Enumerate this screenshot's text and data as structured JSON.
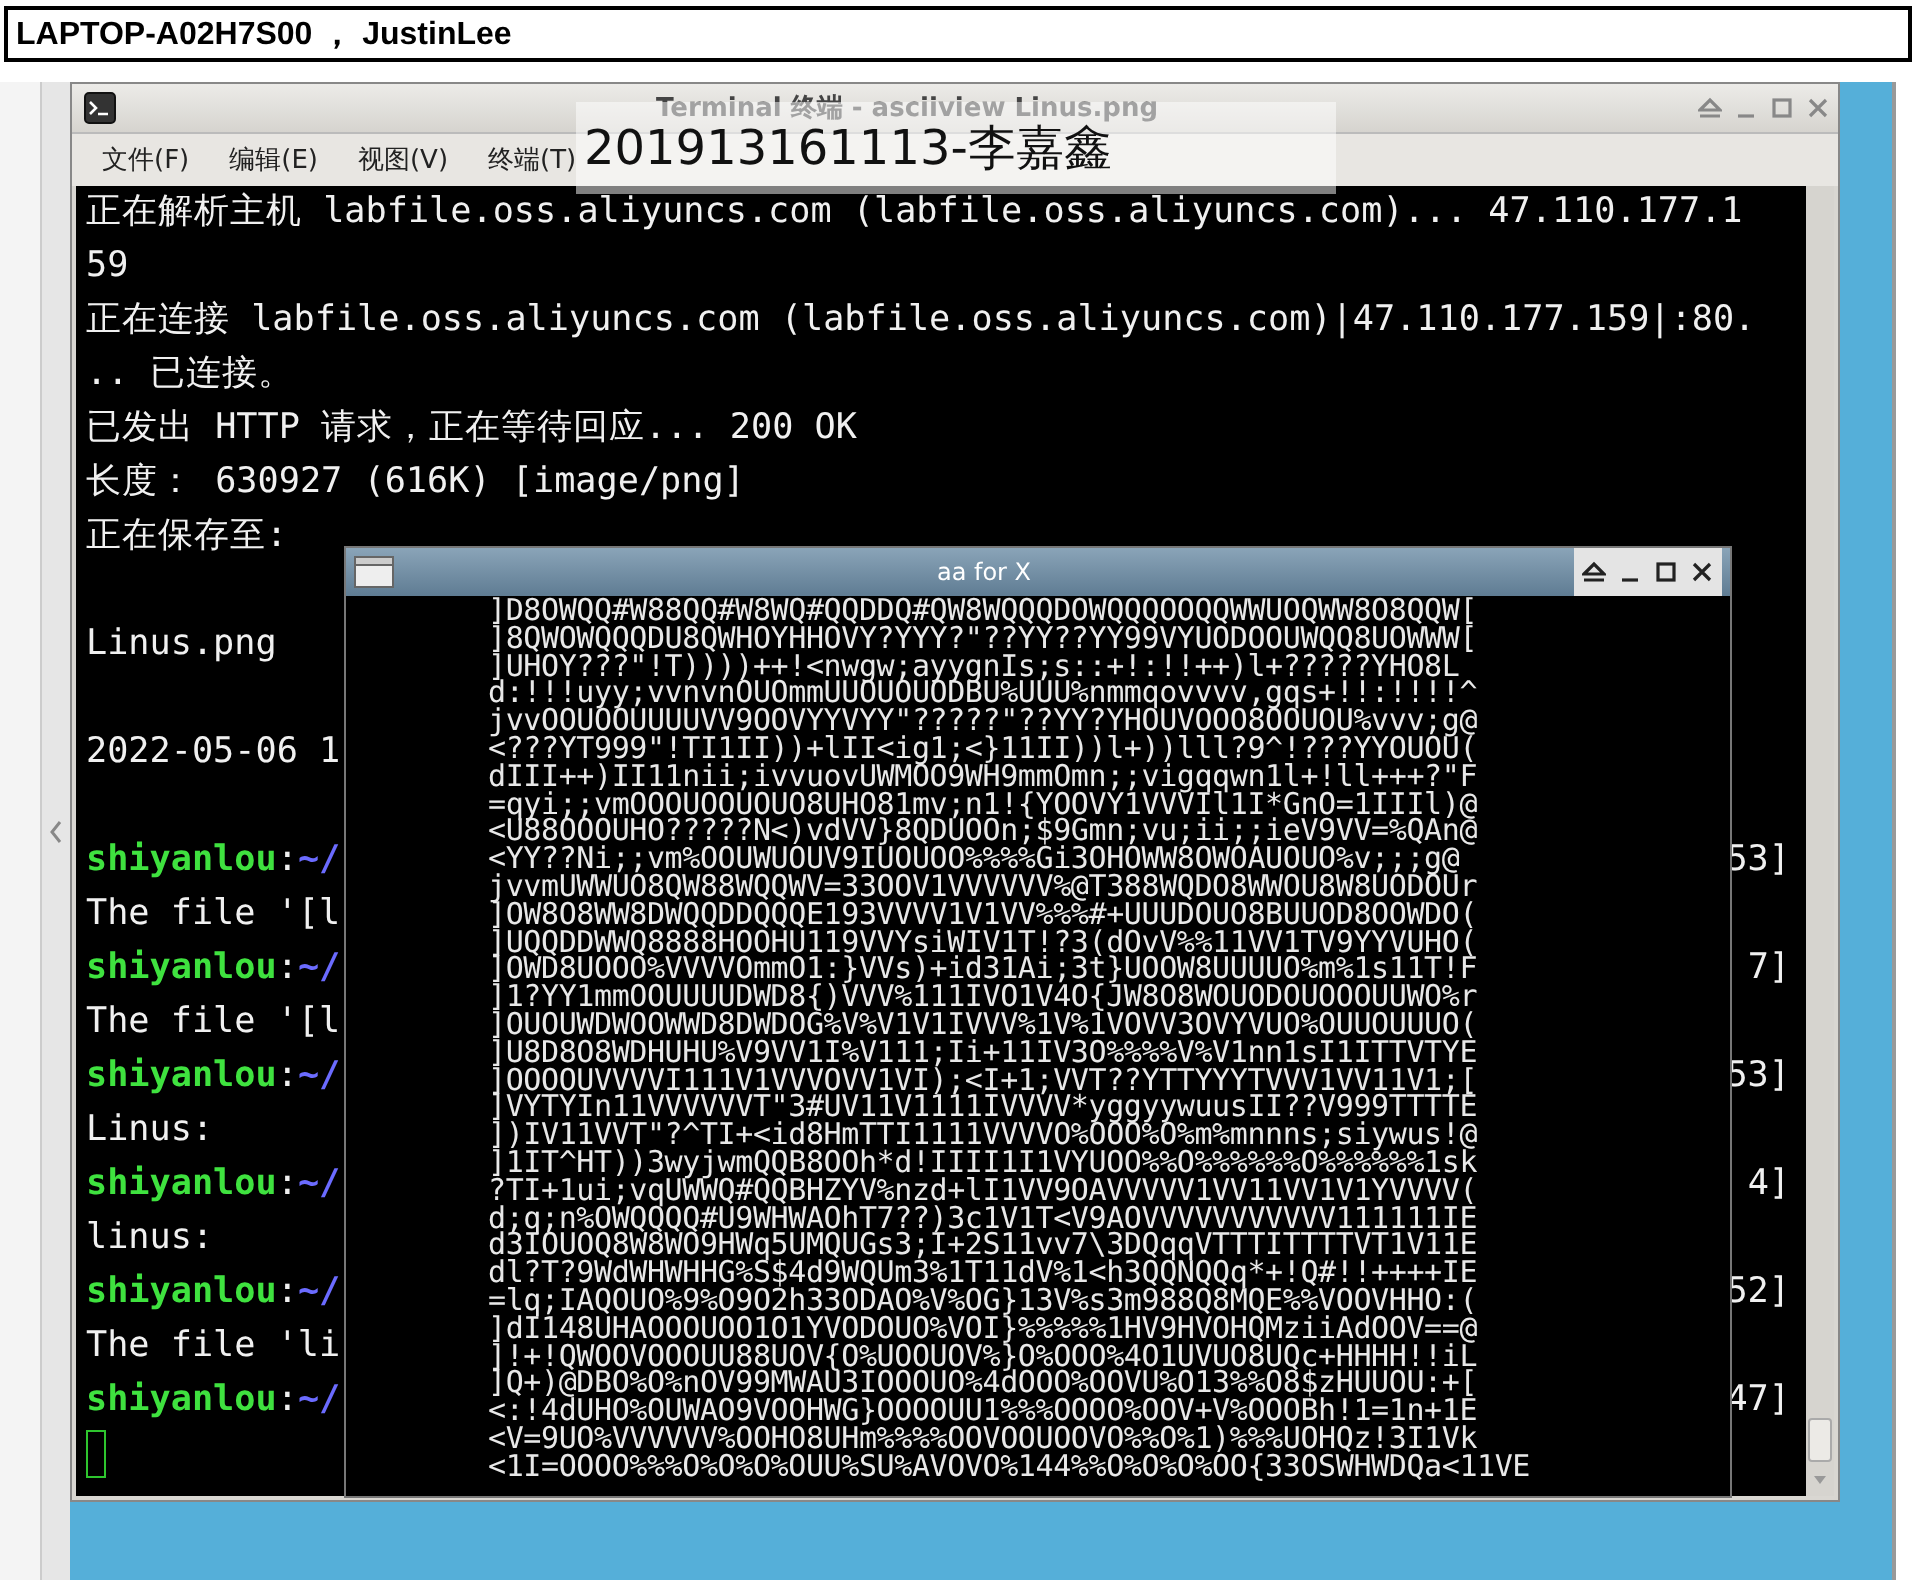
{
  "host_bar": {
    "title": "LAPTOP-A02H7S00 ， JustinLee"
  },
  "overlay_label": "201913161113-李嘉鑫",
  "terminal": {
    "title": "Terminal 终端 - asciiview Linus.png",
    "menu": [
      "文件(F)",
      "编辑(E)",
      "视图(V)",
      "终端(T)"
    ],
    "lines": [
      {
        "kind": "text",
        "text": "正在解析主机 labfile.oss.aliyuncs.com (labfile.oss.aliyuncs.com)... 47.110.177.1"
      },
      {
        "kind": "text",
        "text": "59"
      },
      {
        "kind": "text",
        "text": "正在连接 labfile.oss.aliyuncs.com (labfile.oss.aliyuncs.com)|47.110.177.159|:80."
      },
      {
        "kind": "text",
        "text": ".. 已连接。"
      },
      {
        "kind": "text",
        "text": "已发出 HTTP 请求，正在等待回应... 200 OK"
      },
      {
        "kind": "text",
        "text": "长度： 630927 (616K) [image/png]"
      },
      {
        "kind": "text",
        "text": "正在保存至:"
      },
      {
        "kind": "blank"
      },
      {
        "kind": "text",
        "text": "Linus.png"
      },
      {
        "kind": "blank"
      },
      {
        "kind": "text",
        "text": "2022-05-06 1"
      },
      {
        "kind": "blank"
      },
      {
        "kind": "prompt",
        "user": "shiyanlou",
        "separator": ":",
        "path": "~/",
        "tail": "53]"
      },
      {
        "kind": "text",
        "text": "The file '[l"
      },
      {
        "kind": "prompt",
        "user": "shiyanlou",
        "separator": ":",
        "path": "~/",
        "tail": "7]"
      },
      {
        "kind": "text",
        "text": "The file '[l"
      },
      {
        "kind": "prompt",
        "user": "shiyanlou",
        "separator": ":",
        "path": "~/",
        "tail": "53]"
      },
      {
        "kind": "text",
        "text": "Linus:"
      },
      {
        "kind": "prompt",
        "user": "shiyanlou",
        "separator": ":",
        "path": "~/",
        "tail": "4]"
      },
      {
        "kind": "text",
        "text": "linus:"
      },
      {
        "kind": "prompt",
        "user": "shiyanlou",
        "separator": ":",
        "path": "~/",
        "tail": "52]"
      },
      {
        "kind": "text",
        "text": "The file 'li"
      },
      {
        "kind": "prompt",
        "user": "shiyanlou",
        "separator": ":",
        "path": "~/",
        "tail": "47]"
      },
      {
        "kind": "cursor"
      }
    ]
  },
  "aa_window": {
    "title": "aa for X",
    "art_lines": [
      "]D8OWQQ#W88QQ#W8WQ#QQDDQ#QW8WQQQDOWQQQOOQQWWUOQWW8O8QQW[",
      "]8QWOWQQQDU8QWHOYHHOVY?YYY?\"??YY??YY99VYUODOOUWQQ8UOWWW[",
      "]UHOY???\"!T))))++!<nwgw;ayygnIs;s::+!:!!++)l+?????YHO8L",
      "d:!!!uyy;vvnvnOUOmmUUOUOUODBU%UUU%nmmqovvvv,gqs+!!:!!!!^",
      "jvvOOUOOUUUUVV9OOVYYVYY\"?????\"??YY?YHOUVOOO8OOUOU%vvv;g@",
      "<???YT999\"!TI1II))+lII<ig1;<}11II))l+))lll?9^!???YYOUOU(",
      "dIII++)II11nii;ivvuovUWMOO9WH9mmOmn;;vigqqwn1l+!ll+++?\"F",
      "=qyi;;vmOOOUOOUOUO8UHO81mv;n1!{YOOVY1VVVIl1I*GnO=1IIIl)@",
      "<U88OOOUHO?????N<)vdVV}8QDUOOn;$9Gmn;vu;ii;;ieV9VV=%QAn@",
      "<YY??Ni;;vm%OOUWUOUV9IUOUOO%%%%Gi3OHOWW8OWOAUOUO%v;;;g@",
      "jvvmUWWUO8QW88WQQWV=33OOV1VVVVVV%@T388WQDO8WWOU8W8UODOUr",
      "]OW8O8WW8DWQQDDQQQE193VVVV1V1VV%%%#+UUUDOUO8BUUOD8OOWDO(",
      "]UQQDDWWQ8888HOOHU119VVYsiWIV1T!?3(dOvV%%11VV1TV9YYVUHO(",
      "]OWD8UOOO%VVVVOmmO1:}VVs)+id31Ai;3t}UOOW8UUUUO%m%1s11T!F",
      "]1?YY1mmOOUUUUDWD8{)VVV%111IVO1V4O{JW8O8WOUODOUOOOUUWO%r",
      "]OUOUWDWOOWWD8DWDOG%V%V1V1IVVV%1V%1VOVV3OVYVUO%OUUOUUUO(",
      "]U8D8O8WDHUHU%V9VV1I%V111;Ii+11IV3O%%%%V%V1nn1sI1ITTVTYE",
      "]OOOOUVVVVI111V1VVVOVV1VI);<I+1;VVT??YTTYYYTVVV1VV11V1;[",
      "]VYTYIn11VVVVVVT\"3#UV11V1111IVVVV*yggyywuusII??V999TTTTE",
      "])IV11VVT\"?^TI+<id8HmTTI1111VVVVO%OOO%O%m%mnnns;siywus!@",
      "]1IT^HT))3wyjwmQQB8OOh*d!IIII1I1VYUOO%%O%%%%%%O%%%%%%1sk",
      "?TI+1ui;vqUWWQ#QQBHZYV%nzd+lI1VV9OAVVVVV1VV11VV1V1YVVVV(",
      "d;q;n%OWQQQQ#U9WHWAOhT7??)3c1V1T<V9AOVVVVVVVVVVV111111IE",
      "d3IOUOQ8W8WO9HWq5UMQUGs3;I+2S11vv7\\3DQqqVTTTITTTTVT1V11E",
      "dl?T?9WdWHWHHG%S$4d9WQUm3%1T11dV%1<h3QQNQQq*+!Q#!!++++IE",
      "=lq;IAQOUO%9%O9O2h33ODAO%V%OG}13V%s3m988Q8MQE%%VOOVHHO:(",
      "]dI148UHAOOOUOO1O1YVODOUO%VOI}%%%%%1HV9HVOHQMziiAdOOV==@",
      "]!+!QWOOVOOOUU88UOV{O%UOOUOV%}O%OOO%4O1UVUO8UQc+HHHH!!iL",
      "]Q+)@DBO%O%nOV99MWAU3IOOOUO%4dOOO%OOVU%O13%%O8$zHUUOU:+[",
      "<:!4dUHO%OUWAO9VOOHWG}OOOOUU1%%%OOOO%OOV+V%OOOBh!1=1n+1E",
      "<V=9UO%VVVVVV%OOHO8UHm%%%%OOVOOUOOVO%%O%1)%%%UOHQz!3I1Vk",
      "<1I=OOOO%%%O%O%O%OUU%SU%AVOVO%144%%O%O%O%OO{33OSWHWDQa<11VE"
    ]
  }
}
